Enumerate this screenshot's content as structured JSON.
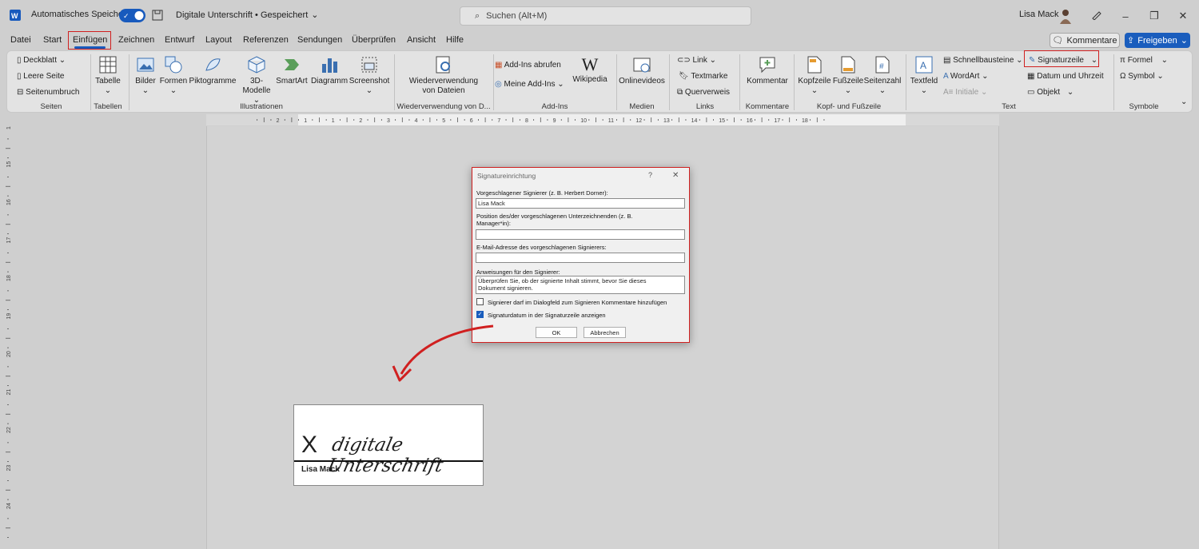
{
  "titlebar": {
    "autosave_label": "Automatisches Speichern",
    "doc_title": "Digitale Unterschrift • Gespeichert",
    "search_placeholder": "Suchen (Alt+M)",
    "user_name": "Lisa Mack"
  },
  "menu": {
    "tabs": [
      "Datei",
      "Start",
      "Einfügen",
      "Zeichnen",
      "Entwurf",
      "Layout",
      "Referenzen",
      "Sendungen",
      "Überprüfen",
      "Ansicht",
      "Hilfe"
    ],
    "active": "Einfügen",
    "comments_label": "Kommentare",
    "share_label": "Freigeben"
  },
  "ribbon": {
    "seiten": {
      "items": [
        "Deckblatt",
        "Leere Seite",
        "Seitenumbruch"
      ],
      "label": "Seiten"
    },
    "tabellen": {
      "item": "Tabelle",
      "label": "Tabellen"
    },
    "illustrationen": {
      "items": [
        "Bilder",
        "Formen",
        "Piktogramme",
        "3D-",
        "Modelle",
        "SmartArt",
        "Diagramm",
        "Screenshot"
      ],
      "label": "Illustrationen"
    },
    "wiederverwendung": {
      "line1": "Wiederverwendung",
      "line2": "von Dateien",
      "label": "Wiederverwendung von D..."
    },
    "addins": {
      "items": [
        "Add-Ins abrufen",
        "Meine Add-Ins",
        "Wikipedia"
      ],
      "label": "Add-Ins"
    },
    "medien": {
      "item": "Onlinevideos",
      "label": "Medien"
    },
    "links": {
      "items": [
        "Link",
        "Textmarke",
        "Querverweis"
      ],
      "label": "Links"
    },
    "kommentare": {
      "item": "Kommentar",
      "label": "Kommentare"
    },
    "kopf": {
      "items": [
        "Kopfzeile",
        "Fußzeile",
        "Seitenzahl"
      ],
      "label": "Kopf- und Fußzeile"
    },
    "text": {
      "items": [
        "Textfeld",
        "Schnellbausteine",
        "WordArt",
        "Initiale",
        "Signaturzeile",
        "Datum und Uhrzeit",
        "Objekt"
      ],
      "label": "Text"
    },
    "symbole": {
      "items": [
        "Formel",
        "Symbol"
      ],
      "label": "Symbole"
    }
  },
  "ruler": {
    "numbers": [
      "2",
      "1",
      "1",
      "2",
      "3",
      "4",
      "5",
      "6",
      "7",
      "8",
      "9",
      "10",
      "11",
      "12",
      "13",
      "14",
      "15",
      "16",
      "17",
      "18"
    ]
  },
  "vruler": {
    "numbers": [
      "14",
      "15",
      "16",
      "17",
      "18",
      "19",
      "20",
      "21",
      "22",
      "23",
      "24"
    ]
  },
  "dialog": {
    "title": "Signatureinrichtung",
    "help": "?",
    "close": "✕",
    "signer_label": "Vorgeschlagener Signierer (z. B. Herbert Dorner):",
    "signer_value": "Lisa Mack",
    "position_label": "Position des/der vorgeschlagenen Unterzeichnenden (z. B. Manager*in):",
    "position_value": "",
    "email_label": "E-Mail-Adresse des vorgeschlagenen Signierers:",
    "email_value": "",
    "instructions_label": "Anweisungen für den Signierer:",
    "instructions_value": "Überprüfen Sie, ob der signierte Inhalt stimmt, bevor Sie dieses Dokument signieren.",
    "check1_label": "Signierer darf im Dialogfeld zum Signieren Kommentare hinzufügen",
    "check1_checked": false,
    "check2_label": "Signaturdatum in der Signaturzeile anzeigen",
    "check2_checked": true,
    "ok": "OK",
    "cancel": "Abbrechen"
  },
  "signature": {
    "x": "X",
    "script": "digitale Unterschrift",
    "name": "Lisa Mack"
  },
  "colors": {
    "accent": "#185abd",
    "highlight": "#d02020"
  }
}
